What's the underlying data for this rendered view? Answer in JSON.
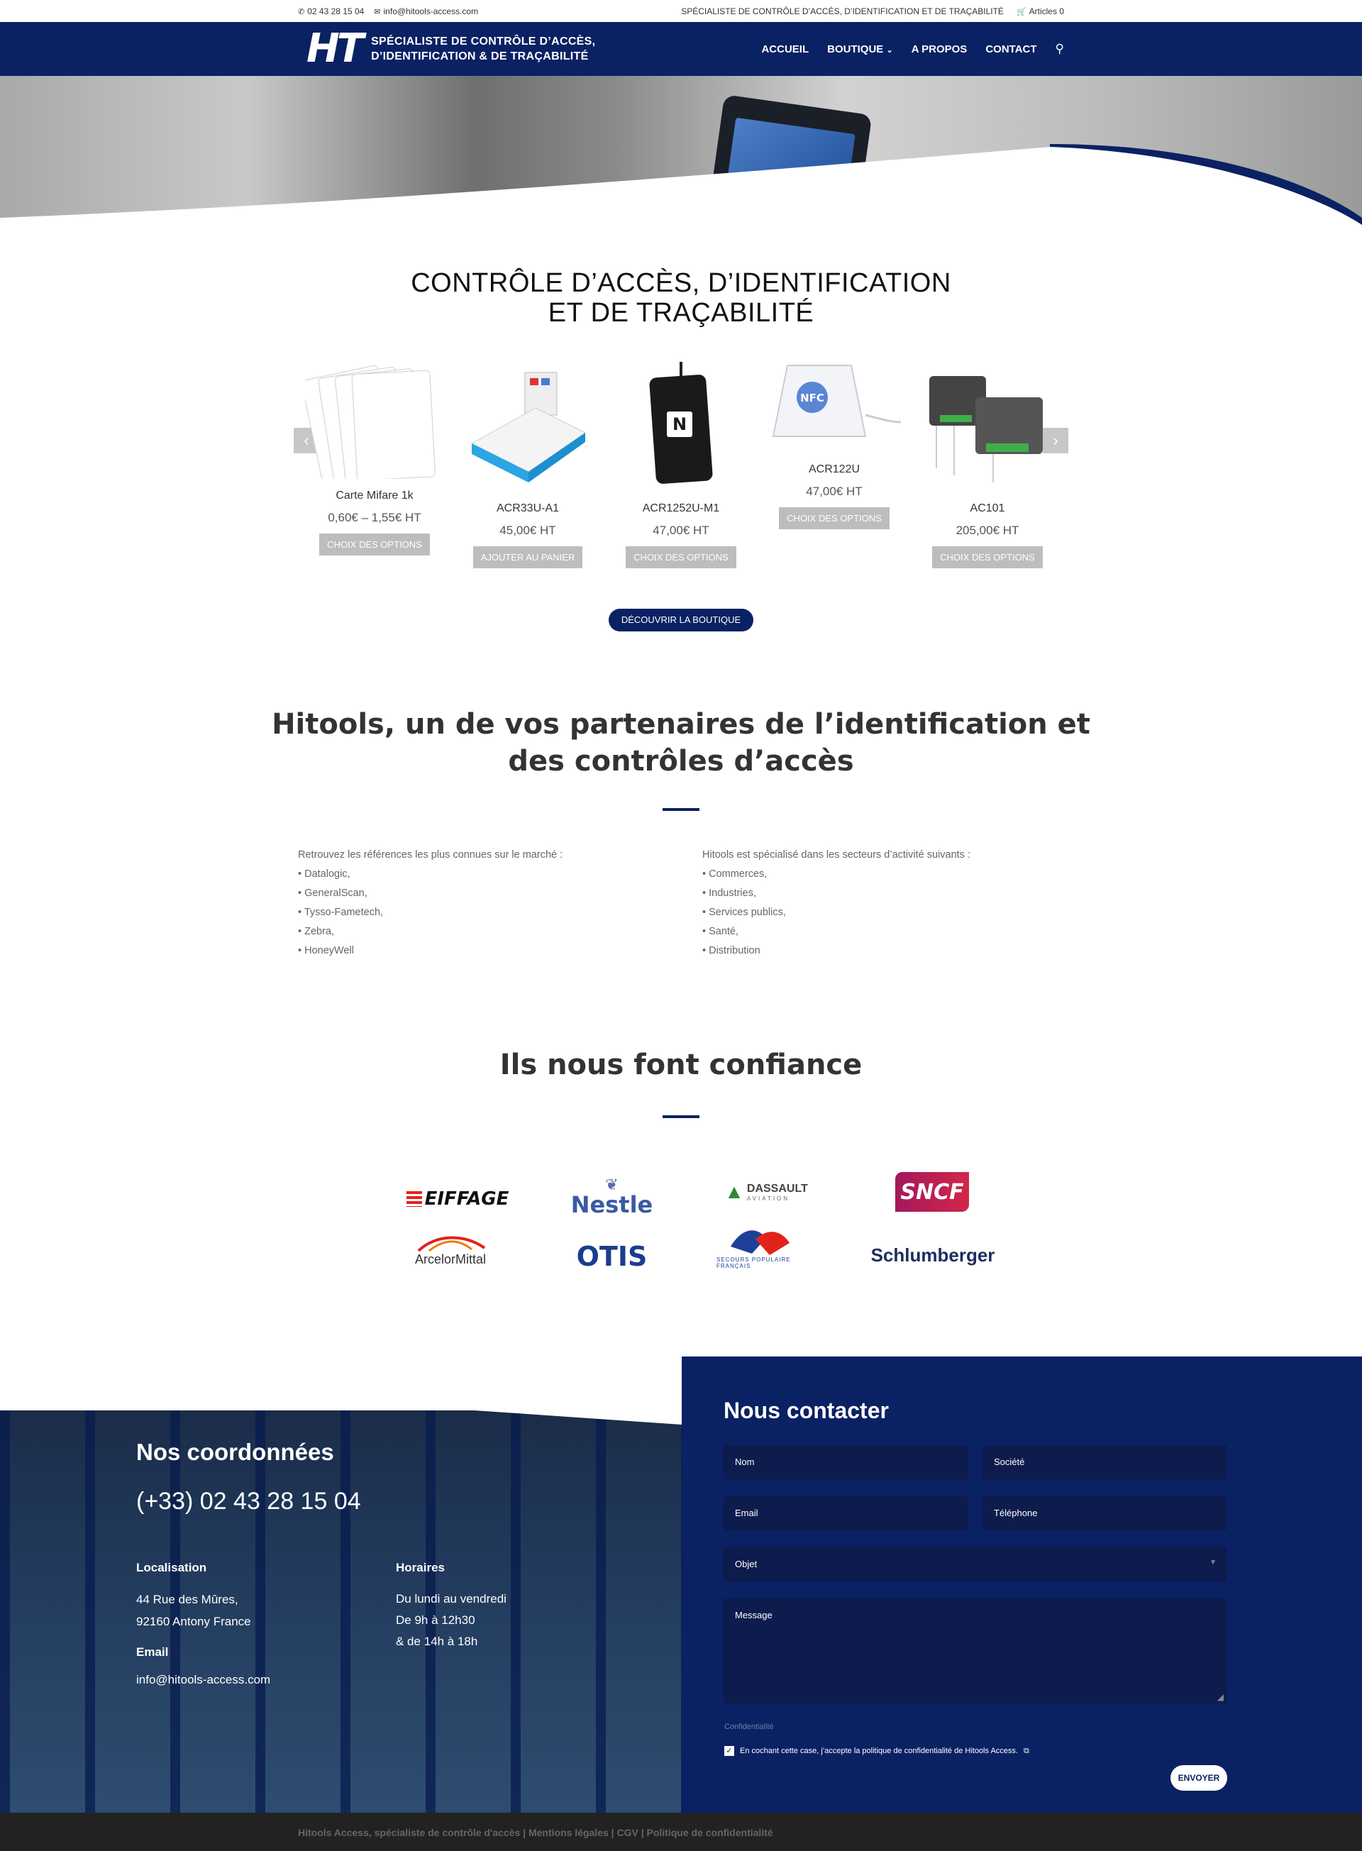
{
  "topbar": {
    "phone": "02 43 28 15 04",
    "email": "info@hitools-access.com",
    "tagline": "SPÉCIALISTE DE CONTRÔLE D’ACCÈS, D’IDENTIFICATION ET DE TRAÇABILITÉ",
    "cart": "Articles 0"
  },
  "header": {
    "logo_mark": "HT",
    "logo_line1": "SPÉCIALISTE DE CONTRÔLE D’ACCÈS,",
    "logo_line2": "D’IDENTIFICATION & DE TRAÇABILITÉ",
    "nav": [
      "ACCUEIL",
      "BOUTIQUE",
      "A PROPOS",
      "CONTACT"
    ]
  },
  "section1": {
    "title_line1": "CONTRÔLE D’ACCÈS, D’IDENTIFICATION",
    "title_line2": "ET DE TRAÇABILITÉ",
    "products": [
      {
        "name": "Carte Mifare 1k",
        "price": "0,60€ – 1,55€ HT",
        "button": "CHOIX DES OPTIONS"
      },
      {
        "name": "ACR33U-A1",
        "price": "45,00€ HT",
        "button": "AJOUTER AU PANIER"
      },
      {
        "name": "ACR1252U-M1",
        "price": "47,00€ HT",
        "button": "CHOIX DES OPTIONS"
      },
      {
        "name": "ACR122U",
        "price": "47,00€ HT",
        "button": "CHOIX DES OPTIONS"
      },
      {
        "name": "AC101",
        "price": "205,00€ HT",
        "button": "CHOIX DES OPTIONS"
      }
    ],
    "shop_button": "DÉCOUVRIR LA BOUTIQUE"
  },
  "section2": {
    "title_line1": "Hitools, un de vos partenaires de l’identification et",
    "title_line2": "des contrôles d’accès",
    "left": {
      "intro": "Retrouvez les références les plus connues sur le marché :",
      "items": [
        "• Datalogic,",
        "• GeneralScan,",
        "• Tysso-Fametech,",
        "• Zebra,",
        "• HoneyWell"
      ]
    },
    "right": {
      "intro": "Hitools est spécialisé dans les secteurs d’activité suivants :",
      "items": [
        "• Commerces,",
        "• Industries,",
        "• Services publics,",
        "• Santé,",
        "• Distribution"
      ]
    }
  },
  "section3": {
    "title": "Ils nous font confiance",
    "logos": {
      "eiffage": "EIFFAGE",
      "nestle": "Nestle",
      "dassault": "DASSAULT",
      "dassault_sub": "AVIATION",
      "sncf": "SNCF",
      "arcelor": "ArcelorMittal",
      "otis": "OTIS",
      "secours": "SECOURS POPULAIRE FRANÇAIS",
      "schlumberger": "Schlumberger"
    }
  },
  "coordonnees": {
    "title": "Nos coordonnées",
    "phone": "(+33) 02 43 28 15 04",
    "location_label": "Localisation",
    "address_line1": "44 Rue des Mûres,",
    "address_line2": "92160 Antony France",
    "hours_label": "Horaires",
    "hours_line1": "Du lundi au vendredi",
    "hours_line2": "De 9h à 12h30",
    "hours_line3": "& de 14h à 18h",
    "email_label": "Email",
    "email": "info@hitools-access.com"
  },
  "contact_form": {
    "title": "Nous contacter",
    "nom": "Nom",
    "societe": "Société",
    "email": "Email",
    "telephone": "Téléphone",
    "objet": "Objet",
    "message": "Message",
    "privacy_label": "Confidentialité",
    "privacy_text": "En cochant cette case, j’accepte la politique de confidentialité de Hitools Access.",
    "send": "ENVOYER"
  },
  "footer": {
    "text": "Hitools Access, spécialiste de contrôle d'accès | Mentions légales | CGV | Politique de confidentialité"
  }
}
